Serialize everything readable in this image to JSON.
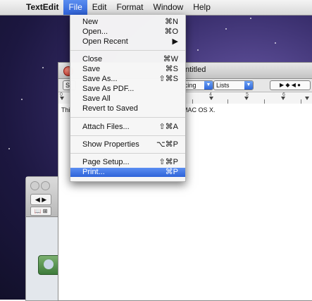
{
  "menubar": {
    "items": [
      "TextEdit",
      "File",
      "Edit",
      "Format",
      "Window",
      "Help"
    ]
  },
  "file_menu": {
    "items": [
      {
        "label": "New",
        "shortcut": "⌘N"
      },
      {
        "label": "Open...",
        "shortcut": "⌘O"
      },
      {
        "label": "Open Recent",
        "shortcut": "▶"
      },
      {
        "label": "Close",
        "shortcut": "⌘W"
      },
      {
        "label": "Save",
        "shortcut": "⌘S"
      },
      {
        "label": "Save As...",
        "shortcut": "⇧⌘S"
      },
      {
        "label": "Save As PDF...",
        "shortcut": ""
      },
      {
        "label": "Save All",
        "shortcut": ""
      },
      {
        "label": "Revert to Saved",
        "shortcut": ""
      },
      {
        "label": "Attach Files...",
        "shortcut": "⇧⌘A"
      },
      {
        "label": "Show Properties",
        "shortcut": "⌥⌘P"
      },
      {
        "label": "Page Setup...",
        "shortcut": "⇧⌘P"
      },
      {
        "label": "Print...",
        "shortcut": "⌘P"
      }
    ]
  },
  "textedit": {
    "title": "ntitled",
    "toolbar": {
      "spacing": "cing",
      "lists": "Lists",
      "style_fragment": "St"
    },
    "ruler_numbers": [
      "0",
      "3",
      "4",
      "5",
      "6"
    ],
    "content_left": "Thi",
    "content_right": "MAC OS X."
  },
  "finder": {
    "nav": "◀ ▶",
    "view": "📖 ⊞"
  }
}
